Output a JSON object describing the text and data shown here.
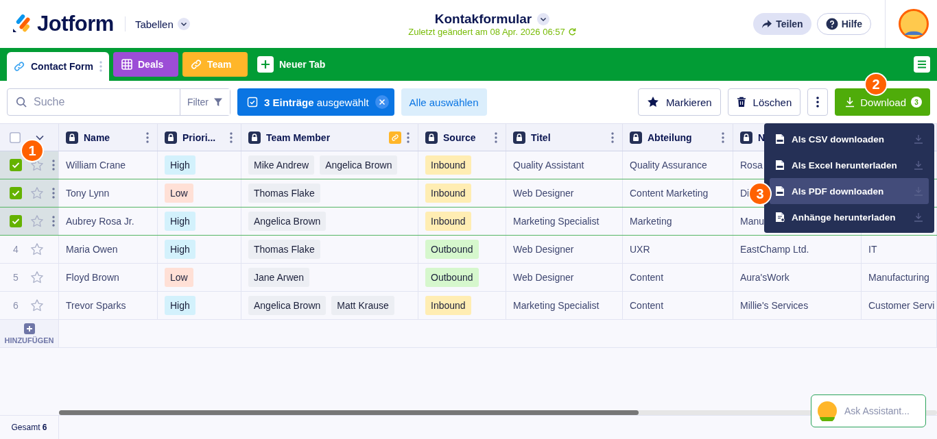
{
  "header": {
    "logo": "Jotform",
    "menu": "Tabellen",
    "title": "Kontakformular",
    "subtitle": "Zuletzt geändert am 08 Apr. 2026 06:57",
    "share": "Teilen",
    "help": "Hilfe"
  },
  "tabs": [
    {
      "label": "Contact Form",
      "kind": "link",
      "selected": true,
      "color": "#ffffff"
    },
    {
      "label": "Deals",
      "kind": "grid",
      "selected": false,
      "color": "#9c4dd6"
    },
    {
      "label": "Team",
      "kind": "link",
      "selected": false,
      "color": "#ffb629"
    }
  ],
  "new_tab": "Neuer Tab",
  "toolbar": {
    "search_placeholder": "Suche",
    "filter": "Filter",
    "selection": "**3 Einträge** ausgewählt",
    "select_all": "Alle auswählen",
    "star": "Markieren",
    "delete": "Löschen",
    "download": "Download",
    "download_badge": "3"
  },
  "table": {
    "columns": [
      {
        "label": "Name",
        "linked": false
      },
      {
        "label": "Priori...",
        "linked": false
      },
      {
        "label": "Team Member",
        "linked": true
      },
      {
        "label": "Source",
        "linked": false
      },
      {
        "label": "Titel",
        "linked": false
      },
      {
        "label": "Abteilung",
        "linked": false
      },
      {
        "label": "N",
        "linked": false
      }
    ],
    "rows": [
      {
        "selected": true,
        "starred": false,
        "name": "William Crane",
        "priority": {
          "label": "High",
          "color": "#d3f1fc"
        },
        "team": [
          "Mike Andrew",
          "Angelica Brown"
        ],
        "source": {
          "label": "Inbound",
          "color": "#ffedb3"
        },
        "title": "Quality Assistant",
        "department": "Quality Assurance",
        "column_8": "Rosa"
      },
      {
        "selected": true,
        "starred": false,
        "name": "Tony Lynn",
        "priority": {
          "label": "Low",
          "color": "#ffe0d6"
        },
        "team": [
          "Thomas Flake"
        ],
        "source": {
          "label": "Inbound",
          "color": "#ffedb3"
        },
        "title": "Web Designer",
        "department": "Content Marketing",
        "column_8": "Di"
      },
      {
        "selected": true,
        "starred": false,
        "name": "Aubrey Rosa Jr.",
        "priority": {
          "label": "High",
          "color": "#d3f1fc"
        },
        "team": [
          "Angelica Brown"
        ],
        "source": {
          "label": "Inbound",
          "color": "#ffedb3"
        },
        "title": "Marketing Specialist",
        "department": "Marketing",
        "column_8": "Manu"
      },
      {
        "selected": false,
        "starred": false,
        "number": "4",
        "name": "Maria Owen",
        "priority": {
          "label": "High",
          "color": "#d3f1fc"
        },
        "team": [
          "Thomas Flake"
        ],
        "source": {
          "label": "Outbound",
          "color": "#d6f7cd"
        },
        "title": "Web Designer",
        "department": "UXR",
        "column_8": "EastChamp Ltd.",
        "column_9": "IT"
      },
      {
        "selected": false,
        "starred": false,
        "number": "5",
        "name": "Floyd Brown",
        "priority": {
          "label": "Low",
          "color": "#ffe0d6"
        },
        "team": [
          "Jane Arwen"
        ],
        "source": {
          "label": "Outbound",
          "color": "#d6f7cd"
        },
        "title": "Web Designer",
        "department": "Content",
        "column_8": "Aura'sWork",
        "column_9": "Manufacturing"
      },
      {
        "selected": false,
        "starred": false,
        "number": "6",
        "name": "Trevor Sparks",
        "priority": {
          "label": "High",
          "color": "#d3f1fc"
        },
        "team": [
          "Angelica Brown",
          "Matt Krause"
        ],
        "source": {
          "label": "Inbound",
          "color": "#ffedb3"
        },
        "title": "Marketing Specialist",
        "department": "Content",
        "column_8": "Millie's Services",
        "column_9": "Customer Servi"
      }
    ],
    "add_row": "HINZUFÜGEN"
  },
  "download_menu": [
    {
      "label": "Als CSV downloaden",
      "kind": "csv",
      "selected": false
    },
    {
      "label": "Als Excel herunterladen",
      "kind": "xlsx",
      "selected": false
    },
    {
      "label": "Als PDF downloaden",
      "kind": "pdf",
      "selected": true
    },
    {
      "label": "Anhänge herunterladen",
      "kind": "attach",
      "selected": false
    }
  ],
  "markers": [
    "1",
    "2",
    "3"
  ],
  "footer": {
    "total": "Gesamt **6**",
    "assistant": "Ask Assistant..."
  }
}
